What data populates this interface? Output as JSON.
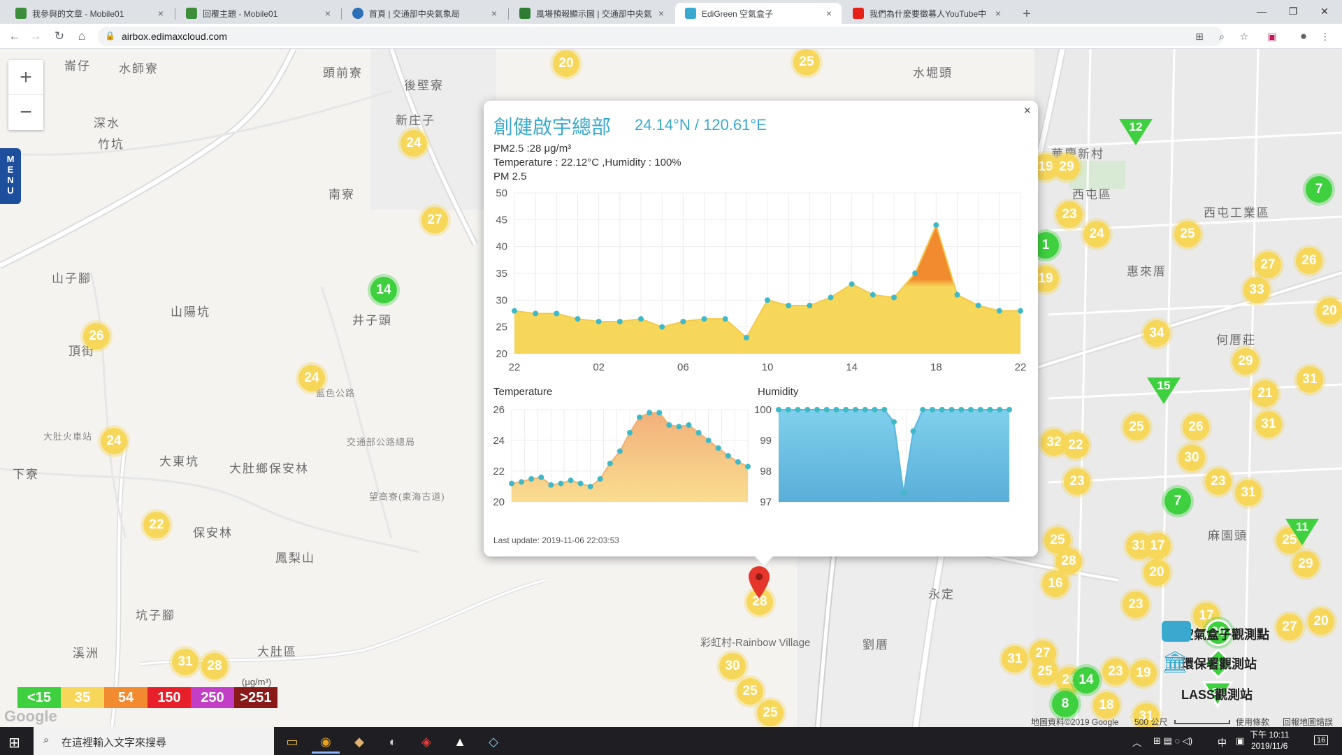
{
  "browser": {
    "tabs": [
      {
        "title": "我參與的文章 - Mobile01",
        "active": false,
        "color": "#3c8d3c"
      },
      {
        "title": "回覆主題 - Mobile01",
        "active": false,
        "color": "#3c8d3c"
      },
      {
        "title": "首頁 | 交通部中央氣象局",
        "active": false,
        "color": "#2a6fb8"
      },
      {
        "title": "風場預報顯示圖 | 交通部中央氣",
        "active": false,
        "color": "#2e7d32"
      },
      {
        "title": "EdiGreen 空氣盒子",
        "active": true,
        "color": "#3aa9cf"
      },
      {
        "title": "我們為什麼要徵募人YouTube中",
        "active": false,
        "color": "#e62117"
      }
    ],
    "url": "airbox.edimaxcloud.com",
    "new_tab": "+",
    "close_glyph": "×"
  },
  "map": {
    "zoom_in": "+",
    "zoom_out": "−",
    "menu_label": [
      "M",
      "E",
      "N",
      "U"
    ],
    "places": [
      {
        "text": "崙仔"
      },
      {
        "text": "水師寮"
      },
      {
        "text": "頭前寮"
      },
      {
        "text": "後壁寮"
      },
      {
        "text": "新庄子"
      },
      {
        "text": "深水"
      },
      {
        "text": "竹坑"
      },
      {
        "text": "南寮"
      },
      {
        "text": "山子腳"
      },
      {
        "text": "山陽坑"
      },
      {
        "text": "井子頭"
      },
      {
        "text": "頂街"
      },
      {
        "text": "大東坑"
      },
      {
        "text": "大肚鄉保安林"
      },
      {
        "text": "下寮"
      },
      {
        "text": "保安林"
      },
      {
        "text": "鳳梨山"
      },
      {
        "text": "坑子腳"
      },
      {
        "text": "溪洲"
      },
      {
        "text": "大肚區"
      },
      {
        "text": "水堀頭"
      },
      {
        "text": "華慶新村"
      },
      {
        "text": "西屯區"
      },
      {
        "text": "西屯工業區"
      },
      {
        "text": "惠來厝"
      },
      {
        "text": "何厝莊"
      },
      {
        "text": "麻園頭"
      },
      {
        "text": "永定"
      },
      {
        "text": "劉厝"
      },
      {
        "text": "彩虹村-Rainbow Village"
      },
      {
        "text": "大肚火車站"
      },
      {
        "text": "交通部公路總局"
      },
      {
        "text": "望高寮(東海古道)"
      },
      {
        "text": "藍色公路"
      }
    ],
    "markers_yellow": [
      "20",
      "25",
      "24",
      "27",
      "26",
      "24",
      "24",
      "22",
      "31",
      "28",
      "30",
      "25",
      "25",
      "28",
      "19",
      "29",
      "23",
      "24",
      "25",
      "19",
      "26",
      "27",
      "33",
      "20",
      "34",
      "29",
      "31",
      "21",
      "31",
      "25",
      "26",
      "30",
      "23",
      "31",
      "32",
      "22",
      "23",
      "25",
      "28",
      "16",
      "31",
      "17",
      "20",
      "23",
      "17",
      "27",
      "20",
      "31",
      "27",
      "25",
      "23",
      "19",
      "26",
      "18",
      "31",
      "29",
      "25"
    ],
    "markers_green": [
      "14",
      "1",
      "7",
      "7",
      "14",
      "8",
      "20"
    ],
    "triangles": [
      "12",
      "15",
      "11"
    ],
    "legend": [
      {
        "label": "<15",
        "color": "#3ed03e"
      },
      {
        "label": "35",
        "color": "#f7d75a"
      },
      {
        "label": "54",
        "color": "#f28b30"
      },
      {
        "label": "150",
        "color": "#e8202a"
      },
      {
        "label": "250",
        "color": "#c33ec6"
      },
      {
        "label": ">251",
        "color": "#8a1a1a"
      }
    ],
    "legend_unit": "(μg/m³)",
    "google_logo": "Google",
    "map_legend": {
      "airbox": "空氣盒子觀測點",
      "epa": "環保署觀測站",
      "lass": "LASS觀測站"
    },
    "footer": {
      "data": "地圖資料©2019 Google",
      "scale": "500 公尺",
      "terms": "使用條款",
      "report": "回報地圖錯誤"
    }
  },
  "popup": {
    "close": "×",
    "title": "創健啟宇總部",
    "coords": "24.14°N / 120.61°E",
    "pm25_text": "PM2.5 :28 μg/m³",
    "temp_humidity_text": "Temperature : 22.12°C ,Humidity : 100%",
    "pm_chart_label": "PM 2.5",
    "temp_chart_label": "Temperature",
    "humidity_chart_label": "Humidity",
    "last_update": "Last update: 2019-11-06 22:03:53",
    "marker_value": "28"
  },
  "chart_data": [
    {
      "type": "area",
      "title": "PM 2.5",
      "x_ticks": [
        "22",
        "02",
        "06",
        "10",
        "14",
        "18",
        "22"
      ],
      "y_ticks": [
        "50",
        "45",
        "40",
        "35",
        "30",
        "25",
        "20"
      ],
      "ylim": [
        20,
        50
      ],
      "values": [
        28,
        27.5,
        27.5,
        26.5,
        26,
        26,
        26.5,
        25,
        26,
        26.5,
        26.5,
        23,
        30,
        29,
        29,
        30.5,
        33,
        31,
        30.5,
        35,
        44,
        31,
        29,
        28,
        28
      ],
      "colors": {
        "fill": "#f7d75a",
        "peak": "#f28b30",
        "point": "#40b9c7"
      }
    },
    {
      "type": "area",
      "title": "Temperature",
      "y_ticks": [
        "26",
        "24",
        "22",
        "20"
      ],
      "ylim": [
        20,
        26
      ],
      "values": [
        21.2,
        21.3,
        21.5,
        21.6,
        21.1,
        21.2,
        21.4,
        21.2,
        21.0,
        21.5,
        22.5,
        23.3,
        24.5,
        25.5,
        25.8,
        25.8,
        25.0,
        24.9,
        25.0,
        24.5,
        24.0,
        23.5,
        23.0,
        22.6,
        22.3
      ],
      "colors": {
        "fill": "#f5c27a",
        "point": "#40b9c7"
      }
    },
    {
      "type": "area",
      "title": "Humidity",
      "y_ticks": [
        "100",
        "99",
        "98",
        "97"
      ],
      "ylim": [
        97,
        100
      ],
      "values": [
        100,
        100,
        100,
        100,
        100,
        100,
        100,
        100,
        100,
        100,
        100,
        100,
        99.6,
        97.3,
        99.3,
        100,
        100,
        100,
        100,
        100,
        100,
        100,
        100,
        100,
        100
      ],
      "colors": {
        "fill": "#62b8e0",
        "point": "#40b9c7"
      }
    }
  ],
  "taskbar": {
    "search_placeholder": "在這裡輸入文字來搜尋",
    "time": "下午 10:11",
    "date": "2019/11/6",
    "ime": "中",
    "notif": "16"
  }
}
